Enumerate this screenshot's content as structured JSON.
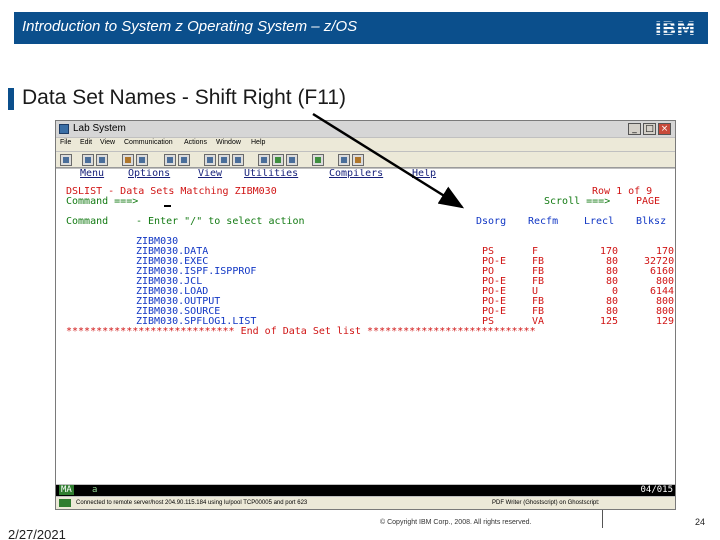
{
  "header": {
    "title": "Introduction to System z Operating System – z/OS",
    "logo": "IBM"
  },
  "slide": {
    "title": "Data Set Names  -  Shift Right (F11)"
  },
  "window": {
    "title": "Lab System",
    "minimize": "_",
    "maximize": "□",
    "close": "×",
    "menu": [
      "File",
      "Edit",
      "View",
      "Communication",
      "Actions",
      "Window",
      "Help"
    ]
  },
  "terminal": {
    "pf_menu": {
      "menu": "Menu",
      "options": "Options",
      "view": "View",
      "utilities": "Utilities",
      "compilers": "Compilers",
      "help": "Help"
    },
    "title_line": "DSLIST - Data Sets Matching ZIBM030",
    "row_info": "Row 1 of 9",
    "command_label": "Command ===>",
    "scroll_label": "Scroll ===>",
    "scroll_value": "PAGE",
    "header_command": "Command",
    "header_action": "- Enter \"/\" to select action",
    "col_headers": [
      "Dsorg",
      "Recfm",
      "Lrecl",
      "Blksz"
    ],
    "rows": [
      {
        "name": "ZIBM030",
        "dsorg": "",
        "recfm": "",
        "lrecl": "",
        "blksz": ""
      },
      {
        "name": "ZIBM030.DATA",
        "dsorg": "PS",
        "recfm": "F",
        "lrecl": "170",
        "blksz": "170"
      },
      {
        "name": "ZIBM030.EXEC",
        "dsorg": "PO-E",
        "recfm": "FB",
        "lrecl": "80",
        "blksz": "32720"
      },
      {
        "name": "ZIBM030.ISPF.ISPPROF",
        "dsorg": "PO",
        "recfm": "FB",
        "lrecl": "80",
        "blksz": "6160"
      },
      {
        "name": "ZIBM030.JCL",
        "dsorg": "PO-E",
        "recfm": "FB",
        "lrecl": "80",
        "blksz": "800"
      },
      {
        "name": "ZIBM030.LOAD",
        "dsorg": "PO-E",
        "recfm": "U",
        "lrecl": "0",
        "blksz": "6144"
      },
      {
        "name": "ZIBM030.OUTPUT",
        "dsorg": "PO-E",
        "recfm": "FB",
        "lrecl": "80",
        "blksz": "800"
      },
      {
        "name": "ZIBM030.SOURCE",
        "dsorg": "PO-E",
        "recfm": "FB",
        "lrecl": "80",
        "blksz": "800"
      },
      {
        "name": "ZIBM030.SPFLOG1.LIST",
        "dsorg": "PS",
        "recfm": "VA",
        "lrecl": "125",
        "blksz": "129"
      }
    ],
    "end_line": "**************************** End of Data Set list ****************************"
  },
  "oia": {
    "left": "MA",
    "left_sub": "a",
    "right": "04/015"
  },
  "statusbar": {
    "connection": "Connected to remote server/host 204.90.115.184 using lu/pool TCP00005 and port 623",
    "printer": "PDF Writer (Ghostscript) on Ghostscript:"
  },
  "footer": {
    "date": "2/27/2021",
    "copyright": "© Copyright IBM Corp., 2008. All rights reserved.",
    "page": "24"
  },
  "colors": {
    "brand": "#0b4f8c",
    "terminal_red": "#d01414",
    "terminal_blue": "#1036c4",
    "terminal_green": "#137a13"
  },
  "icons": [
    "ibm-logo",
    "app-icon",
    "minimize-icon",
    "maximize-icon",
    "close-icon",
    "annotation-arrow"
  ]
}
